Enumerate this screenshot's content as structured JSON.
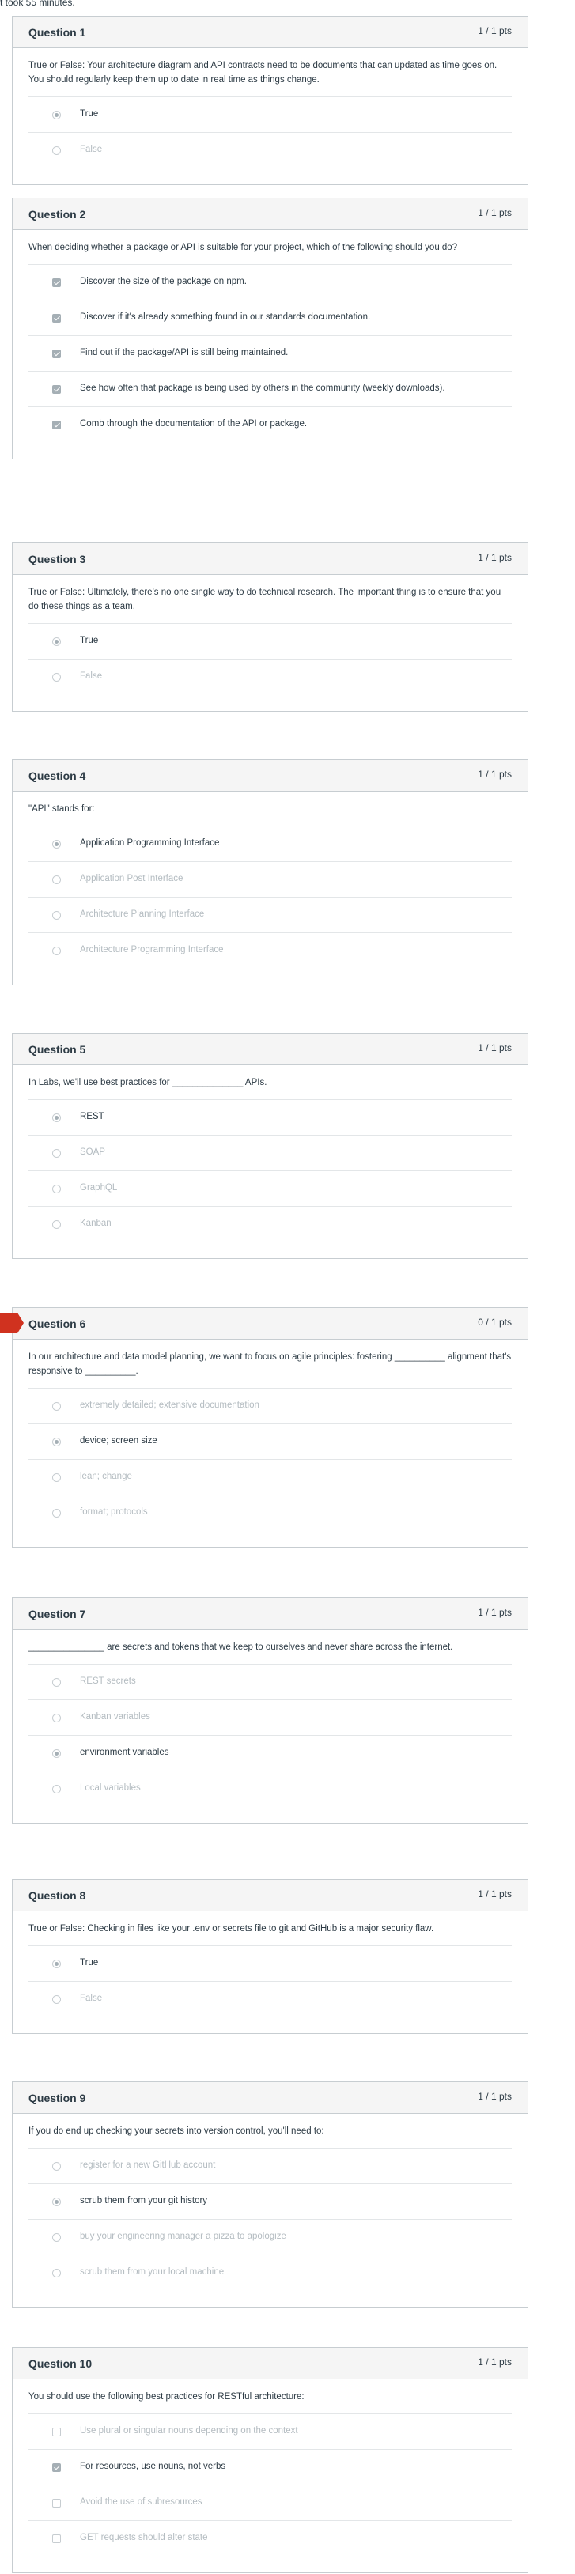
{
  "header": {
    "note": "t took 55 minutes."
  },
  "colors": {
    "incorrect_flag": "#d0321f",
    "header_bg": "#f5f5f5",
    "border": "#c7cdd1"
  },
  "questions": [
    {
      "title": "Question 1",
      "points": "1 / 1 pts",
      "type": "radio",
      "flagged": false,
      "text": "True or False: Your architecture diagram and API contracts need to be documents that can updated as time goes on. You should regularly keep them up to date in real time as things change.",
      "answers": [
        {
          "label": "True",
          "selected": true
        },
        {
          "label": "False",
          "selected": false
        }
      ]
    },
    {
      "title": "Question 2",
      "points": "1 / 1 pts",
      "type": "checkbox",
      "flagged": false,
      "text": "When deciding whether a package or API is suitable for your project, which of the following should you do?",
      "answers": [
        {
          "label": "Discover the size of the package on npm.",
          "selected": true
        },
        {
          "label": "Discover if it's already something found in our standards documentation.",
          "selected": true
        },
        {
          "label": "Find out if the package/API is still being maintained.",
          "selected": true
        },
        {
          "label": "See how often that package is being used by others in the community (weekly downloads).",
          "selected": true
        },
        {
          "label": "Comb through the documentation of the API or package.",
          "selected": true
        }
      ]
    },
    {
      "title": "Question 3",
      "points": "1 / 1 pts",
      "type": "radio",
      "flagged": false,
      "text": "True or False: Ultimately, there's no one single way to do technical research. The important thing is to ensure that you do these things as a team.",
      "answers": [
        {
          "label": "True",
          "selected": true
        },
        {
          "label": "False",
          "selected": false
        }
      ]
    },
    {
      "title": "Question 4",
      "points": "1 / 1 pts",
      "type": "radio",
      "flagged": false,
      "text": "\"API\" stands for:",
      "answers": [
        {
          "label": "Application Programming Interface",
          "selected": true
        },
        {
          "label": "Application Post Interface",
          "selected": false
        },
        {
          "label": "Architecture Planning Interface",
          "selected": false
        },
        {
          "label": "Architecture Programming Interface",
          "selected": false
        }
      ]
    },
    {
      "title": "Question 5",
      "points": "1 / 1 pts",
      "type": "radio",
      "flagged": false,
      "text": "In Labs, we'll use best practices for ______________ APIs.",
      "answers": [
        {
          "label": "REST",
          "selected": true
        },
        {
          "label": "SOAP",
          "selected": false
        },
        {
          "label": "GraphQL",
          "selected": false
        },
        {
          "label": "Kanban",
          "selected": false
        }
      ]
    },
    {
      "title": "Question 6",
      "points": "0 / 1 pts",
      "type": "radio",
      "flagged": true,
      "text": "In our architecture and data model planning, we want to focus on agile principles: fostering __________ alignment that's responsive to __________.",
      "answers": [
        {
          "label": "extremely detailed; extensive documentation",
          "selected": false
        },
        {
          "label": "device; screen size",
          "selected": true
        },
        {
          "label": "lean; change",
          "selected": false
        },
        {
          "label": "format; protocols",
          "selected": false
        }
      ]
    },
    {
      "title": "Question 7",
      "points": "1 / 1 pts",
      "type": "radio",
      "flagged": false,
      "text": "_______________ are secrets and tokens that we keep to ourselves and never share across the internet.",
      "answers": [
        {
          "label": "REST secrets",
          "selected": false
        },
        {
          "label": "Kanban variables",
          "selected": false
        },
        {
          "label": "environment variables",
          "selected": true
        },
        {
          "label": "Local variables",
          "selected": false
        }
      ]
    },
    {
      "title": "Question 8",
      "points": "1 / 1 pts",
      "type": "radio",
      "flagged": false,
      "text": "True or False: Checking in files like your .env or secrets file to git and GitHub is a major security flaw.",
      "answers": [
        {
          "label": "True",
          "selected": true
        },
        {
          "label": "False",
          "selected": false
        }
      ]
    },
    {
      "title": "Question 9",
      "points": "1 / 1 pts",
      "type": "radio",
      "flagged": false,
      "text": "If you do end up checking your secrets into version control, you'll need to:",
      "answers": [
        {
          "label": "register for a new GitHub account",
          "selected": false
        },
        {
          "label": "scrub them from your git history",
          "selected": true
        },
        {
          "label": "buy your engineering manager a pizza to apologize",
          "selected": false
        },
        {
          "label": "scrub them from your local machine",
          "selected": false
        }
      ]
    },
    {
      "title": "Question 10",
      "points": "1 / 1 pts",
      "type": "checkbox",
      "flagged": false,
      "text": "You should use the following best practices for RESTful architecture:",
      "answers": [
        {
          "label": "Use plural or singular nouns depending on the context",
          "selected": false
        },
        {
          "label": "For resources, use nouns, not verbs",
          "selected": true
        },
        {
          "label": "Avoid the use of subresources",
          "selected": false
        },
        {
          "label": "GET requests should alter state",
          "selected": false
        }
      ]
    }
  ]
}
